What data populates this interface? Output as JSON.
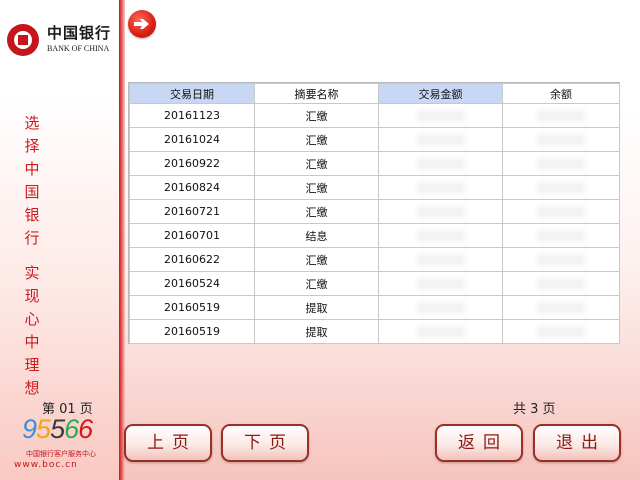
{
  "brand": {
    "name_cn": "中国银行",
    "name_en": "BANK OF CHINA",
    "slogan_line1": "选择中国银行",
    "slogan_line2": "实现心中理想",
    "hotline_number": [
      "9",
      "5",
      "5",
      "6",
      "6"
    ],
    "hotline_text": "中国银行客户服务中心",
    "website": "www.boc.cn",
    "accent_color": "#c4161c"
  },
  "table": {
    "headers": [
      "交易日期",
      "摘要名称",
      "交易金额",
      "余额"
    ],
    "rows": [
      {
        "date": "20161123",
        "summary": "汇缴"
      },
      {
        "date": "20161024",
        "summary": "汇缴"
      },
      {
        "date": "20160922",
        "summary": "汇缴"
      },
      {
        "date": "20160824",
        "summary": "汇缴"
      },
      {
        "date": "20160721",
        "summary": "汇缴"
      },
      {
        "date": "20160701",
        "summary": "结息"
      },
      {
        "date": "20160622",
        "summary": "汇缴"
      },
      {
        "date": "20160524",
        "summary": "汇缴"
      },
      {
        "date": "20160519",
        "summary": "提取"
      },
      {
        "date": "20160519",
        "summary": "提取"
      }
    ]
  },
  "pagination": {
    "current_label": "第 01 页",
    "total_label": "共 3 页"
  },
  "buttons": {
    "prev": "上页",
    "next": "下页",
    "back": "返回",
    "exit": "退出"
  },
  "icons": {
    "top_badge": "pointing-hand-icon",
    "logo": "bank-of-china-logo-icon"
  }
}
